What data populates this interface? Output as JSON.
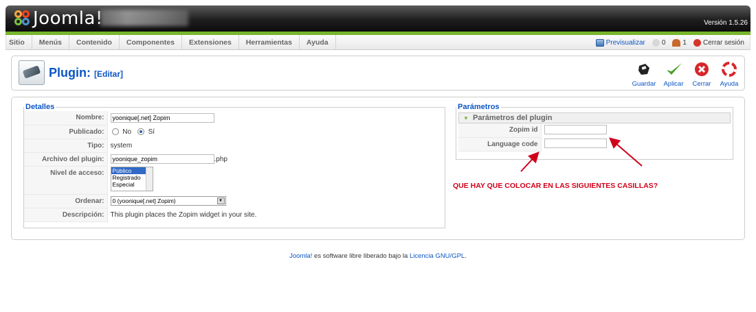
{
  "header": {
    "logo_text": "Joomla!",
    "version": "Versión 1.5.26"
  },
  "menu": [
    "Sitio",
    "Menús",
    "Contenido",
    "Componentes",
    "Extensiones",
    "Herramientas",
    "Ayuda"
  ],
  "status": {
    "preview": "Previsualizar",
    "messages_count": "0",
    "users_count": "1",
    "logout": "Cerrar sesión"
  },
  "page": {
    "title": "Plugin:",
    "subtitle": "[Editar]"
  },
  "toolbar": {
    "save": "Guardar",
    "apply": "Aplicar",
    "close": "Cerrar",
    "help": "Ayuda"
  },
  "details": {
    "legend": "Detalles",
    "name_label": "Nombre:",
    "name_value": "yoonique[.net] Zopim",
    "published_label": "Publicado:",
    "published_no": "No",
    "published_yes": "Sí",
    "published": "Sí",
    "type_label": "Tipo:",
    "type_value": "system",
    "file_label": "Archivo del plugin:",
    "file_value": "yoonique_zopim",
    "file_ext": ".php",
    "access_label": "Nivel de acceso:",
    "access_options": [
      "Público",
      "Registrado",
      "Especial"
    ],
    "access_selected": "Público",
    "order_label": "Ordenar:",
    "order_value": "0 (yoonique[.net] Zopim)",
    "description_label": "Descripción:",
    "description_value": "This plugin places the Zopim widget in your site."
  },
  "params": {
    "legend": "Parámetros",
    "panel_title": "Parámetros del plugin",
    "zopim_label": "Zopim id",
    "zopim_value": "",
    "lang_label": "Language code",
    "lang_value": ""
  },
  "annotation": {
    "question": "QUE HAY QUE COLOCAR EN LAS SIGUIENTES CASILLAS?",
    "color": "#d0001a"
  },
  "footer": {
    "brand": "Joomla!",
    "middle": " es software libre liberado bajo la ",
    "license": "Licencia GNU/GPL",
    "end": "."
  },
  "colors": {
    "accent_green": "#77b52b",
    "link_blue": "#0b55c4"
  }
}
